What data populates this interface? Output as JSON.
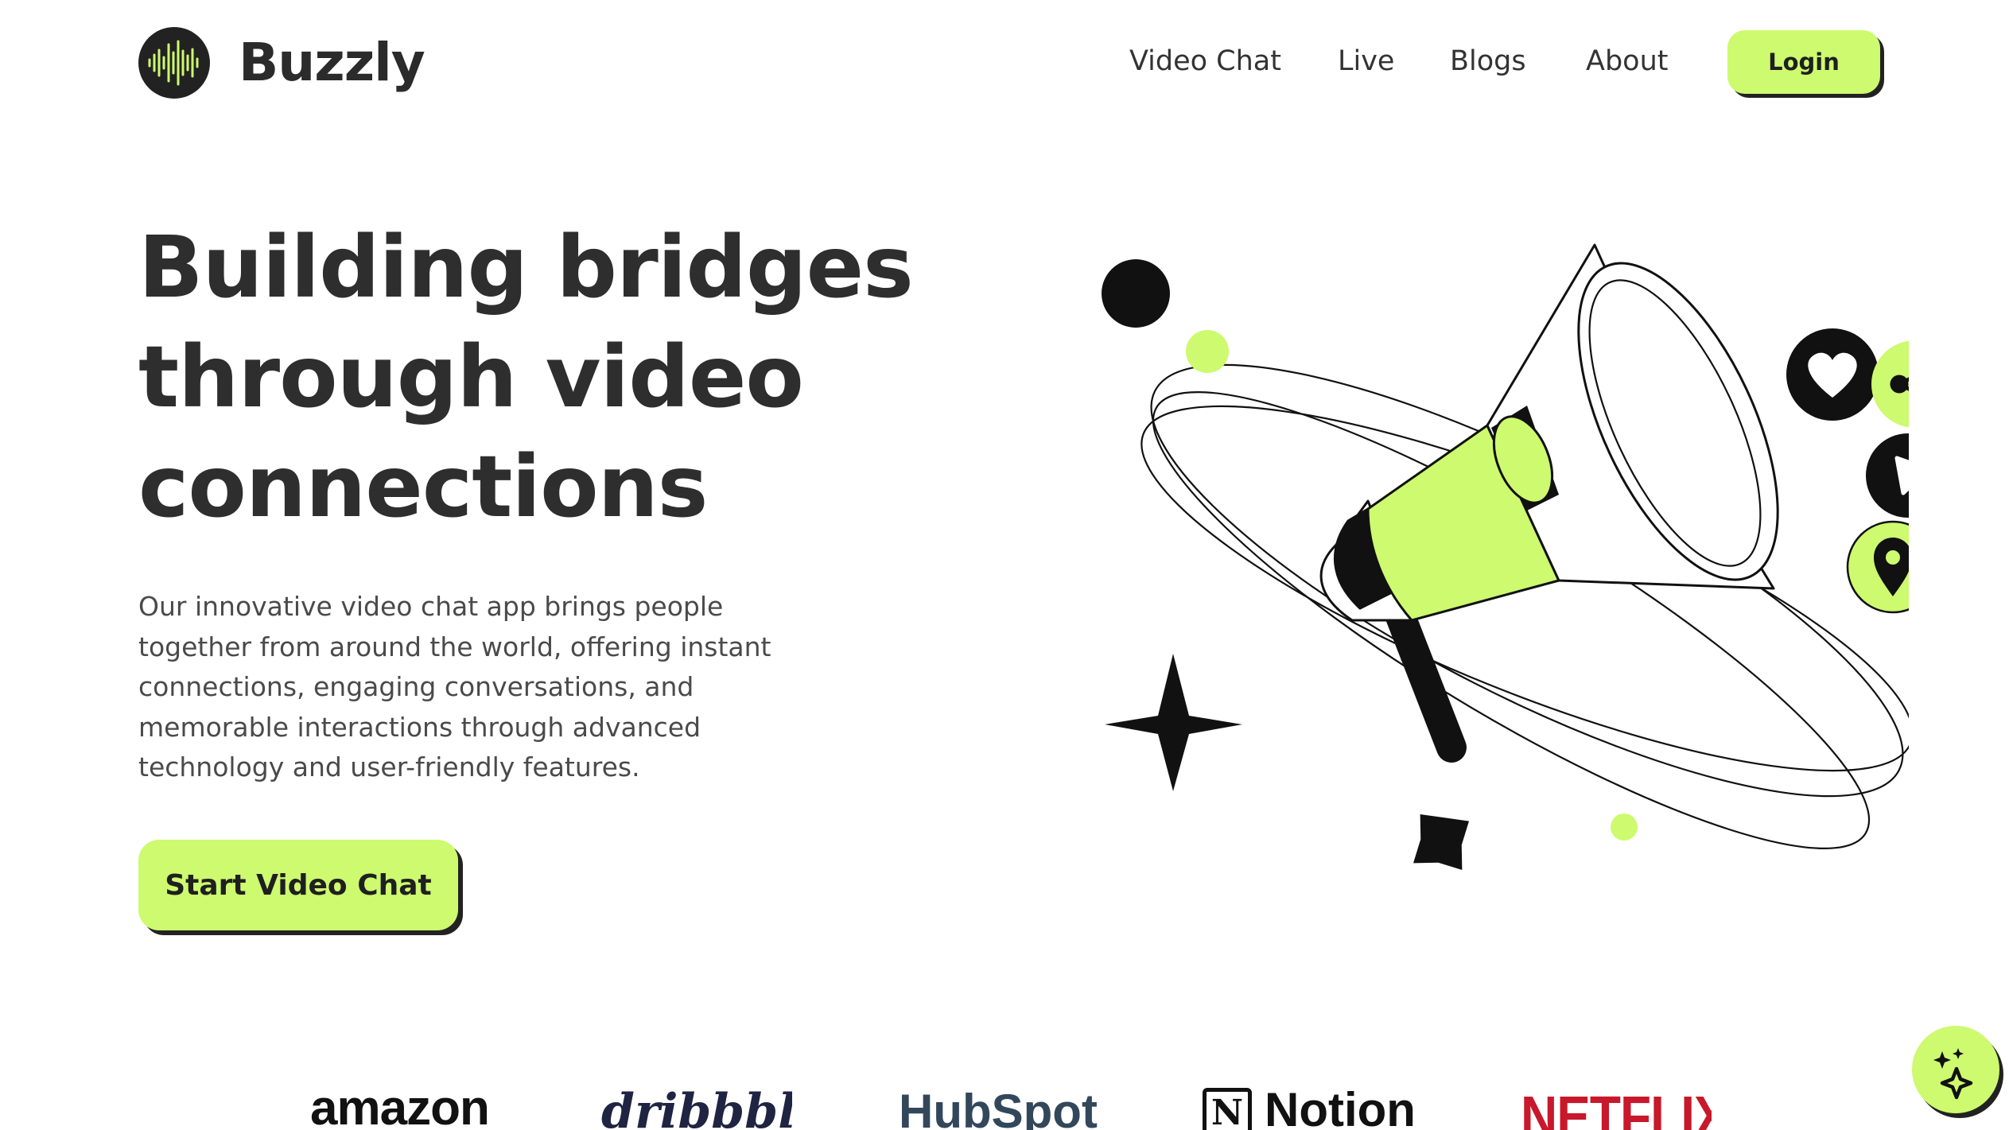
{
  "header": {
    "brand_name": "Buzzly",
    "logo_icon": "soundwave-icon",
    "nav": [
      {
        "label": "Video Chat"
      },
      {
        "label": "Live"
      },
      {
        "label": "Blogs"
      },
      {
        "label": "About"
      }
    ],
    "login_label": "Login"
  },
  "hero": {
    "title": "Building bridges through video connections",
    "description": "Our innovative video chat app brings people together from around the world, offering instant connections, engaging conversations, and memorable interactions through advanced technology and user-friendly features.",
    "cta_label": "Start Video Chat",
    "illustration_icons": [
      "megaphone-icon",
      "heart-icon",
      "share-icon",
      "play-icon",
      "location-pin-icon",
      "scan-icon",
      "sparkle-star-icon"
    ]
  },
  "partners": [
    "amazon",
    "dribbble",
    "HubSpot",
    "Notion",
    "NETFLIX"
  ],
  "fab_icon": "ai-sparkles-icon",
  "colors": {
    "accent": "#cdfa6f",
    "dark": "#1f1f1f",
    "text": "#2e2e2e",
    "netflix": "#c8182b",
    "hubspot": "#33475b"
  }
}
